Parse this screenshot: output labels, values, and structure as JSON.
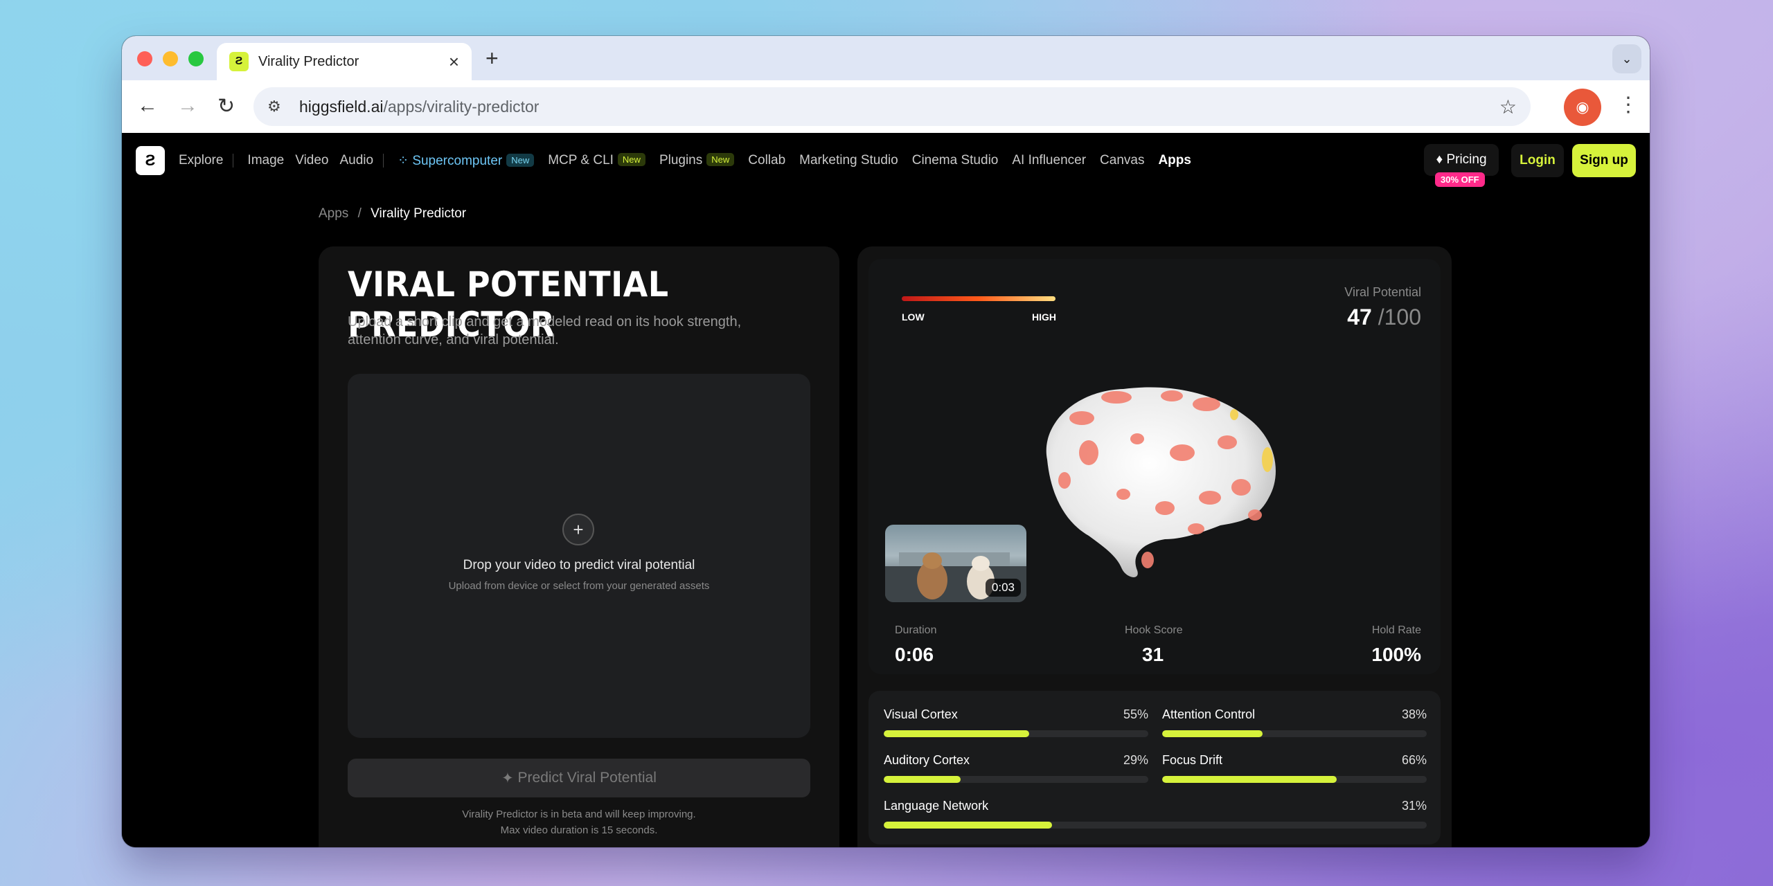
{
  "browser": {
    "tab_title": "Virality Predictor",
    "url_host": "higgsfield.ai",
    "url_path": "/apps/virality-predictor",
    "tab_close": "×",
    "new_tab": "+"
  },
  "nav": {
    "items": [
      "Explore",
      "Image",
      "Video",
      "Audio"
    ],
    "supercomputer": "Supercomputer",
    "supercomputer_badge": "New",
    "mcp": "MCP & CLI",
    "mcp_badge": "New",
    "plugins": "Plugins",
    "plugins_badge": "New",
    "more": [
      "Collab",
      "Marketing Studio",
      "Cinema Studio",
      "AI Influencer",
      "Canvas"
    ],
    "apps": "Apps",
    "pricing": "Pricing",
    "pricing_badge": "30% OFF",
    "login": "Login",
    "signup": "Sign up"
  },
  "breadcrumb": {
    "root": "Apps",
    "sep": "/",
    "current": "Virality Predictor"
  },
  "left": {
    "title": "VIRAL POTENTIAL PREDICTOR",
    "subtitle": "Upload a short clip and get a modeled read on its hook strength, attention curve, and viral potential.",
    "drop_title": "Drop your video to predict viral potential",
    "drop_sub": "Upload from device or select from your generated assets",
    "predict_button": "Predict Viral Potential",
    "note_1": "Virality Predictor is in beta and will keep improving.",
    "note_2": "Max video duration is 15 seconds."
  },
  "right": {
    "scale_low": "LOW",
    "scale_high": "HIGH",
    "viral_label": "Viral Potential",
    "viral_score": "47",
    "viral_max": "/100",
    "thumb_time": "0:03",
    "stats": [
      {
        "label": "Duration",
        "value": "0:06"
      },
      {
        "label": "Hook Score",
        "value": "31"
      },
      {
        "label": "Hold Rate",
        "value": "100%"
      }
    ],
    "metrics": [
      {
        "name": "Visual Cortex",
        "pct": "55%",
        "value": 55
      },
      {
        "name": "Attention Control",
        "pct": "38%",
        "value": 38
      },
      {
        "name": "Auditory Cortex",
        "pct": "29%",
        "value": 29
      },
      {
        "name": "Focus Drift",
        "pct": "66%",
        "value": 66
      },
      {
        "name": "Language Network",
        "pct": "31%",
        "value": 31
      }
    ]
  },
  "colors": {
    "accent": "#d6f23b",
    "badge_pink": "#ff2a8a",
    "super_blue": "#6ec6f5"
  }
}
